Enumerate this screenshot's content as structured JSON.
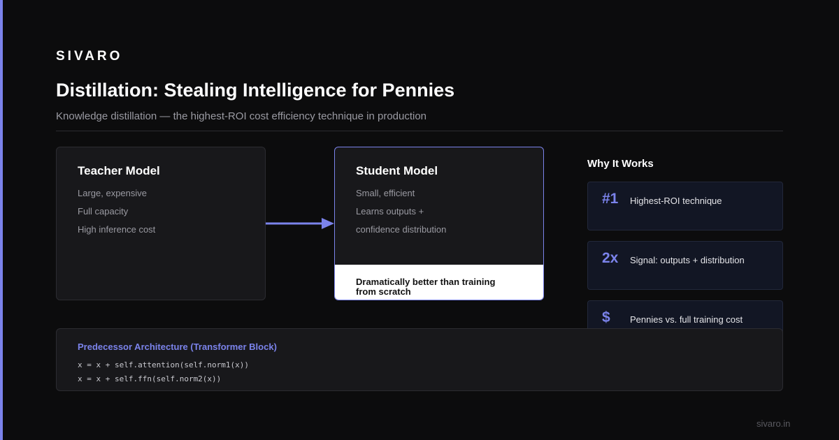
{
  "brand": "SIVARO",
  "title": "Distillation: Stealing Intelligence for Pennies",
  "subtitle": "Knowledge distillation — the highest-ROI cost efficiency technique in production",
  "teacher": {
    "title": "Teacher Model",
    "lines": [
      "Large, expensive",
      "Full capacity",
      "High inference cost"
    ]
  },
  "student": {
    "title": "Student Model",
    "lines": [
      "Small, efficient",
      "Learns outputs +",
      "confidence distribution"
    ],
    "callout": "Dramatically better than training from scratch"
  },
  "why": {
    "heading": "Why It Works",
    "items": [
      {
        "icon": "#1",
        "text": "Highest-ROI technique"
      },
      {
        "icon": "2x",
        "text": "Signal: outputs + distribution"
      },
      {
        "icon": "$",
        "text": "Pennies vs. full training cost"
      }
    ]
  },
  "code": {
    "title": "Predecessor Architecture (Transformer Block)",
    "lines": [
      "x = x + self.attention(self.norm1(x))",
      "x = x + self.ffn(self.norm2(x))"
    ]
  },
  "footer": "sivaro.in",
  "colors": {
    "accent": "#7b83eb",
    "background": "#0c0c0d",
    "card": "#18181b"
  }
}
